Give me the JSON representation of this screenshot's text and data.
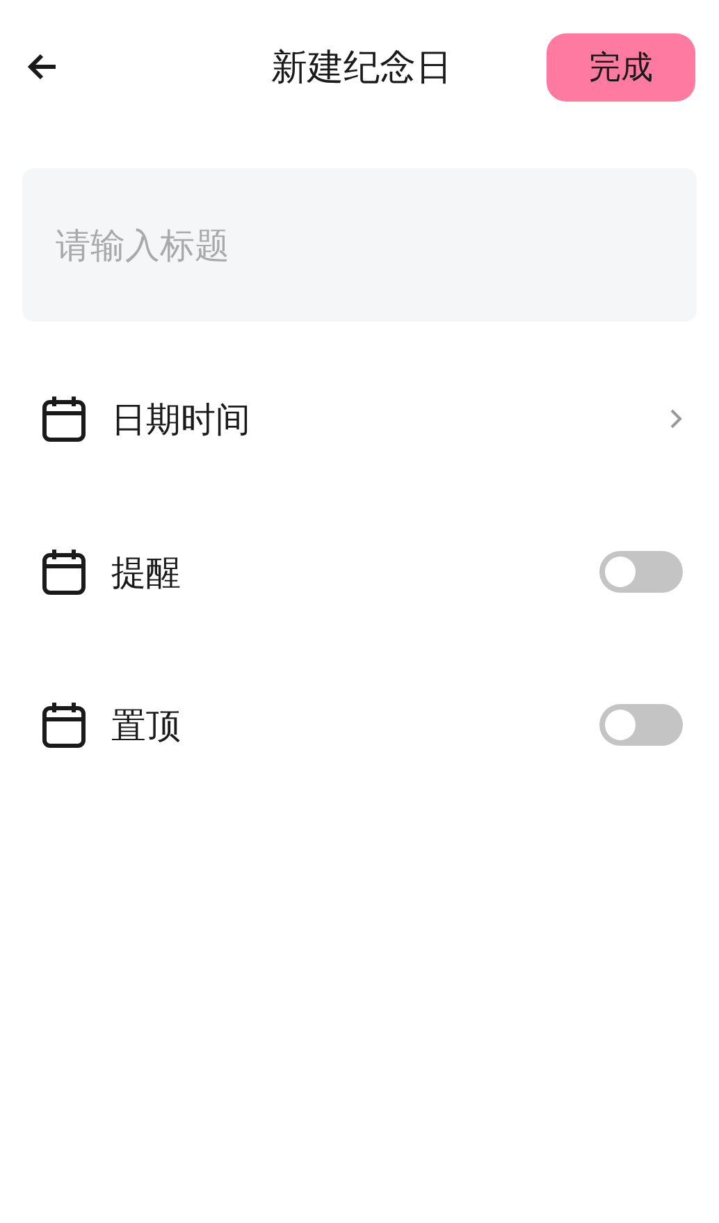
{
  "header": {
    "title": "新建纪念日",
    "done_button": "完成"
  },
  "title_field": {
    "placeholder": "请输入标题"
  },
  "rows": [
    {
      "kind": "link",
      "label": "日期时间"
    },
    {
      "kind": "switch",
      "label": "提醒",
      "on": false
    },
    {
      "kind": "switch",
      "label": "置顶",
      "on": false
    }
  ]
}
